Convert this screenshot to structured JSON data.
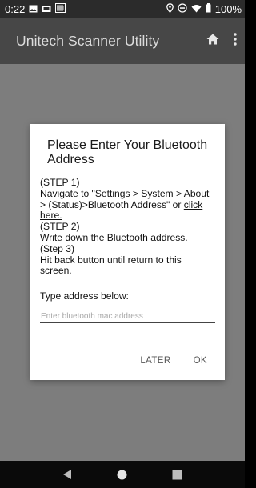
{
  "status_bar": {
    "time": "0:22",
    "battery": "100%"
  },
  "app_bar": {
    "title": "Unitech Scanner Utility"
  },
  "dialog": {
    "title": "Please Enter Your Bluetooth Address",
    "step1_heading": "(STEP 1)",
    "step1_text": "Navigate to \"Settings > System > About > (Status)>Bluetooth Address\" or ",
    "step1_link": "click here.",
    "step2_heading": "(STEP 2)",
    "step2_text": "Write down the Bluetooth address.",
    "step3_heading": "(Step 3)",
    "step3_text": "Hit back button until return to this screen.",
    "address_label": "Type address below:",
    "address_placeholder": "Enter bluetooth mac address",
    "address_value": "",
    "later_button": "LATER",
    "ok_button": "OK"
  },
  "icons": {
    "status_left": [
      "image-icon",
      "screen-mirror-icon",
      "keyboard-icon"
    ],
    "status_right": [
      "location-icon",
      "do-not-disturb-icon",
      "wifi-icon",
      "battery-icon"
    ],
    "app_bar": [
      "home-icon",
      "overflow-menu-icon"
    ],
    "nav": [
      "back-icon",
      "home-circle-icon",
      "recents-icon"
    ]
  }
}
